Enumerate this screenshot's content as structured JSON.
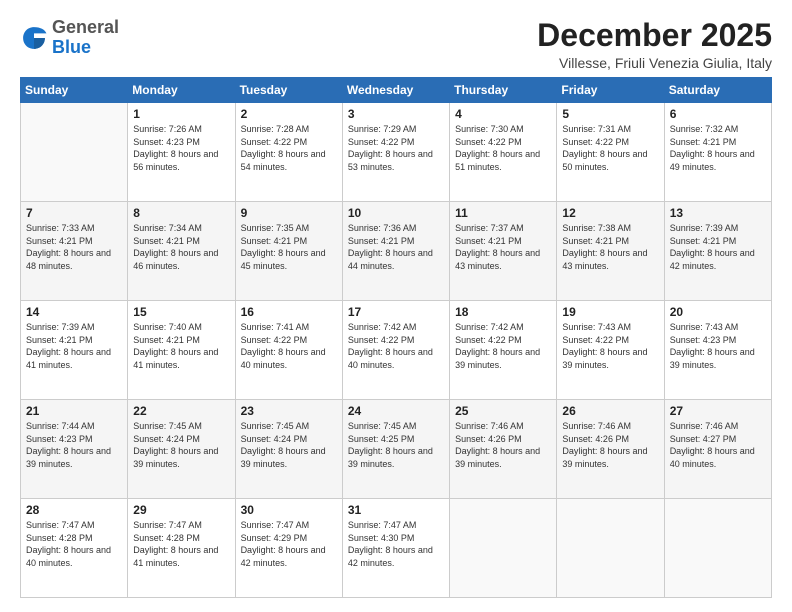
{
  "logo": {
    "general": "General",
    "blue": "Blue"
  },
  "header": {
    "title": "December 2025",
    "subtitle": "Villesse, Friuli Venezia Giulia, Italy"
  },
  "weekdays": [
    "Sunday",
    "Monday",
    "Tuesday",
    "Wednesday",
    "Thursday",
    "Friday",
    "Saturday"
  ],
  "weeks": [
    [
      {
        "day": "",
        "sunrise": "",
        "sunset": "",
        "daylight": ""
      },
      {
        "day": "1",
        "sunrise": "7:26 AM",
        "sunset": "4:23 PM",
        "daylight": "8 hours and 56 minutes."
      },
      {
        "day": "2",
        "sunrise": "7:28 AM",
        "sunset": "4:22 PM",
        "daylight": "8 hours and 54 minutes."
      },
      {
        "day": "3",
        "sunrise": "7:29 AM",
        "sunset": "4:22 PM",
        "daylight": "8 hours and 53 minutes."
      },
      {
        "day": "4",
        "sunrise": "7:30 AM",
        "sunset": "4:22 PM",
        "daylight": "8 hours and 51 minutes."
      },
      {
        "day": "5",
        "sunrise": "7:31 AM",
        "sunset": "4:22 PM",
        "daylight": "8 hours and 50 minutes."
      },
      {
        "day": "6",
        "sunrise": "7:32 AM",
        "sunset": "4:21 PM",
        "daylight": "8 hours and 49 minutes."
      }
    ],
    [
      {
        "day": "7",
        "sunrise": "7:33 AM",
        "sunset": "4:21 PM",
        "daylight": "8 hours and 48 minutes."
      },
      {
        "day": "8",
        "sunrise": "7:34 AM",
        "sunset": "4:21 PM",
        "daylight": "8 hours and 46 minutes."
      },
      {
        "day": "9",
        "sunrise": "7:35 AM",
        "sunset": "4:21 PM",
        "daylight": "8 hours and 45 minutes."
      },
      {
        "day": "10",
        "sunrise": "7:36 AM",
        "sunset": "4:21 PM",
        "daylight": "8 hours and 44 minutes."
      },
      {
        "day": "11",
        "sunrise": "7:37 AM",
        "sunset": "4:21 PM",
        "daylight": "8 hours and 43 minutes."
      },
      {
        "day": "12",
        "sunrise": "7:38 AM",
        "sunset": "4:21 PM",
        "daylight": "8 hours and 43 minutes."
      },
      {
        "day": "13",
        "sunrise": "7:39 AM",
        "sunset": "4:21 PM",
        "daylight": "8 hours and 42 minutes."
      }
    ],
    [
      {
        "day": "14",
        "sunrise": "7:39 AM",
        "sunset": "4:21 PM",
        "daylight": "8 hours and 41 minutes."
      },
      {
        "day": "15",
        "sunrise": "7:40 AM",
        "sunset": "4:21 PM",
        "daylight": "8 hours and 41 minutes."
      },
      {
        "day": "16",
        "sunrise": "7:41 AM",
        "sunset": "4:22 PM",
        "daylight": "8 hours and 40 minutes."
      },
      {
        "day": "17",
        "sunrise": "7:42 AM",
        "sunset": "4:22 PM",
        "daylight": "8 hours and 40 minutes."
      },
      {
        "day": "18",
        "sunrise": "7:42 AM",
        "sunset": "4:22 PM",
        "daylight": "8 hours and 39 minutes."
      },
      {
        "day": "19",
        "sunrise": "7:43 AM",
        "sunset": "4:22 PM",
        "daylight": "8 hours and 39 minutes."
      },
      {
        "day": "20",
        "sunrise": "7:43 AM",
        "sunset": "4:23 PM",
        "daylight": "8 hours and 39 minutes."
      }
    ],
    [
      {
        "day": "21",
        "sunrise": "7:44 AM",
        "sunset": "4:23 PM",
        "daylight": "8 hours and 39 minutes."
      },
      {
        "day": "22",
        "sunrise": "7:45 AM",
        "sunset": "4:24 PM",
        "daylight": "8 hours and 39 minutes."
      },
      {
        "day": "23",
        "sunrise": "7:45 AM",
        "sunset": "4:24 PM",
        "daylight": "8 hours and 39 minutes."
      },
      {
        "day": "24",
        "sunrise": "7:45 AM",
        "sunset": "4:25 PM",
        "daylight": "8 hours and 39 minutes."
      },
      {
        "day": "25",
        "sunrise": "7:46 AM",
        "sunset": "4:26 PM",
        "daylight": "8 hours and 39 minutes."
      },
      {
        "day": "26",
        "sunrise": "7:46 AM",
        "sunset": "4:26 PM",
        "daylight": "8 hours and 39 minutes."
      },
      {
        "day": "27",
        "sunrise": "7:46 AM",
        "sunset": "4:27 PM",
        "daylight": "8 hours and 40 minutes."
      }
    ],
    [
      {
        "day": "28",
        "sunrise": "7:47 AM",
        "sunset": "4:28 PM",
        "daylight": "8 hours and 40 minutes."
      },
      {
        "day": "29",
        "sunrise": "7:47 AM",
        "sunset": "4:28 PM",
        "daylight": "8 hours and 41 minutes."
      },
      {
        "day": "30",
        "sunrise": "7:47 AM",
        "sunset": "4:29 PM",
        "daylight": "8 hours and 42 minutes."
      },
      {
        "day": "31",
        "sunrise": "7:47 AM",
        "sunset": "4:30 PM",
        "daylight": "8 hours and 42 minutes."
      },
      {
        "day": "",
        "sunrise": "",
        "sunset": "",
        "daylight": ""
      },
      {
        "day": "",
        "sunrise": "",
        "sunset": "",
        "daylight": ""
      },
      {
        "day": "",
        "sunrise": "",
        "sunset": "",
        "daylight": ""
      }
    ]
  ]
}
